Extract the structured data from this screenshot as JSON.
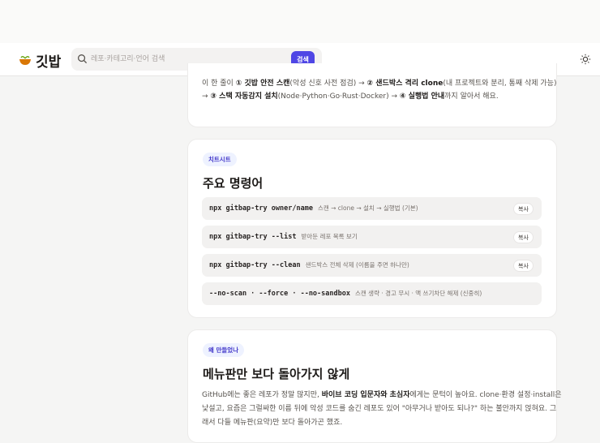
{
  "header": {
    "logo_text": "깃밥",
    "search_placeholder": "레포·카테고리·언어 검색",
    "search_button": "검색"
  },
  "intro": {
    "l1_pre": "이 한 줄이 ",
    "l1_s1": "① 깃밥 안전 스캔",
    "l1_mid": "(악성 신호 사전 점검) → ",
    "l1_s2": "② 샌드박스 격리 clone",
    "l1_post": "(내 프로젝트와 분리, 통째 삭제 가능)",
    "l2_pre": "→ ",
    "l2_s1": "③ 스택 자동감지 설치",
    "l2_mid": "(Node·Python·Go·Rust·Docker) → ",
    "l2_s2": "④ 실행법 안내",
    "l2_post": "까지 알아서 해요."
  },
  "cheatsheet": {
    "pill": "치트시트",
    "title": "주요 명령어",
    "copy_label": "복사",
    "commands": [
      {
        "code": "npx gitbap-try owner/name",
        "desc": "스캔 → clone → 설치 → 실행법 (기본)"
      },
      {
        "code": "npx gitbap-try --list",
        "desc": "받아둔 레포 목록 보기"
      },
      {
        "code": "npx gitbap-try --clean",
        "desc": "샌드박스 전체 삭제 (이름을 주면 하나만)"
      },
      {
        "code": "--no-scan · --force · --no-sandbox",
        "desc": "스캔 생략 · 경고 무시 · 액 쓰기차단 해제 (신중히)"
      }
    ]
  },
  "why": {
    "pill": "왜 만들었나",
    "title": "메뉴판만 보다 돌아가지 않게",
    "l1_pre": "GitHub에는 좋은 레포가 정말 많지만, ",
    "l1_b": "바이브 코딩 입문자와 초심자",
    "l1_post": "에게는 문턱이 높아요. clone·환경 설정·install은",
    "l2": "낯설고, 요즘은 그럴싸한 이름 뒤에 악성 코드를 숨긴 레포도 있어 \"아무거나 받아도 되나?\" 하는 불안까지 얹혀요. 그",
    "l3": "래서 다들 메뉴판(요약)만 보다 돌아가곤 했죠."
  }
}
